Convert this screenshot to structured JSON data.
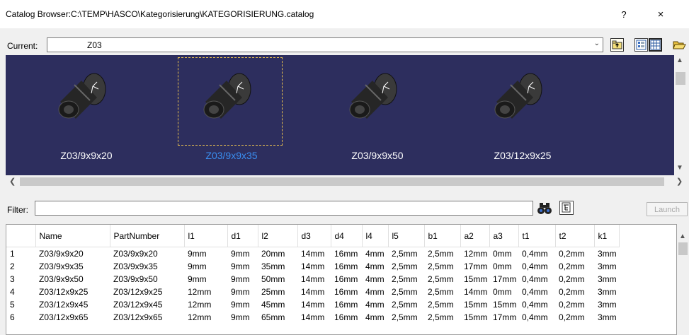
{
  "window": {
    "title": "Catalog Browser:C:\\TEMP\\HASCO\\Kategorisierung\\KATEGORISIERUNG.catalog",
    "help_label": "?",
    "close_label": "×"
  },
  "current": {
    "label": "Current:",
    "value": "Z03"
  },
  "thumbnails": [
    {
      "label": "Z03/9x9x20",
      "selected": false
    },
    {
      "label": "Z03/9x9x35",
      "selected": true
    },
    {
      "label": "Z03/9x9x50",
      "selected": false
    },
    {
      "label": "Z03/12x9x25",
      "selected": false
    }
  ],
  "filter": {
    "label": "Filter:",
    "value": "",
    "launch_label": "Launch"
  },
  "table": {
    "columns": [
      "",
      "Name",
      "PartNumber",
      "l1",
      "d1",
      "l2",
      "d3",
      "d4",
      "l4",
      "l5",
      "b1",
      "a2",
      "a3",
      "t1",
      "t2",
      "k1"
    ],
    "rows": [
      [
        "1",
        "Z03/9x9x20",
        "Z03/9x9x20",
        "9mm",
        "9mm",
        "20mm",
        "14mm",
        "16mm",
        "4mm",
        "2,5mm",
        "2,5mm",
        "12mm",
        "0mm",
        "0,4mm",
        "0,2mm",
        "3mm"
      ],
      [
        "2",
        "Z03/9x9x35",
        "Z03/9x9x35",
        "9mm",
        "9mm",
        "35mm",
        "14mm",
        "16mm",
        "4mm",
        "2,5mm",
        "2,5mm",
        "17mm",
        "0mm",
        "0,4mm",
        "0,2mm",
        "3mm"
      ],
      [
        "3",
        "Z03/9x9x50",
        "Z03/9x9x50",
        "9mm",
        "9mm",
        "50mm",
        "14mm",
        "16mm",
        "4mm",
        "2,5mm",
        "2,5mm",
        "15mm",
        "17mm",
        "0,4mm",
        "0,2mm",
        "3mm"
      ],
      [
        "4",
        "Z03/12x9x25",
        "Z03/12x9x25",
        "12mm",
        "9mm",
        "25mm",
        "14mm",
        "16mm",
        "4mm",
        "2,5mm",
        "2,5mm",
        "14mm",
        "0mm",
        "0,4mm",
        "0,2mm",
        "3mm"
      ],
      [
        "5",
        "Z03/12x9x45",
        "Z03/12x9x45",
        "12mm",
        "9mm",
        "45mm",
        "14mm",
        "16mm",
        "4mm",
        "2,5mm",
        "2,5mm",
        "15mm",
        "15mm",
        "0,4mm",
        "0,2mm",
        "3mm"
      ],
      [
        "6",
        "Z03/12x9x65",
        "Z03/12x9x65",
        "12mm",
        "9mm",
        "65mm",
        "14mm",
        "16mm",
        "4mm",
        "2,5mm",
        "2,5mm",
        "15mm",
        "17mm",
        "0,4mm",
        "0,2mm",
        "3mm"
      ]
    ]
  },
  "colors": {
    "thumb_background": "#2d2e5e",
    "selected_label": "#3a8ef0",
    "selection_border": "#e8c050"
  },
  "icons": {
    "up_folder": "up-folder-icon",
    "list_view": "list-view-icon",
    "detail_view": "detail-view-icon",
    "open_folder": "open-folder-icon",
    "binoculars": "binoculars-icon",
    "filter_tree": "tree-filter-icon"
  }
}
